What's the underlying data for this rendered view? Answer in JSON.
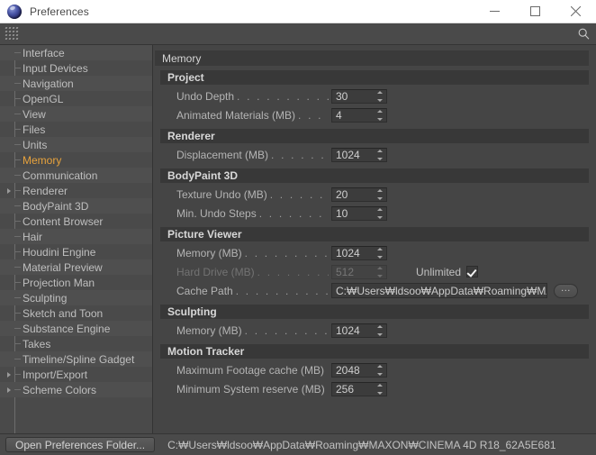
{
  "window": {
    "title": "Preferences",
    "app_icon": "cinema4d-sphere-icon",
    "minimize_label": "Minimize",
    "maximize_label": "Maximize",
    "close_label": "Close"
  },
  "toolbar": {
    "grip_name": "palette-grip",
    "search_icon": "search-icon"
  },
  "sidebar": {
    "items": [
      {
        "label": "Interface",
        "selected": false,
        "expandable": false
      },
      {
        "label": "Input Devices",
        "selected": false,
        "expandable": false
      },
      {
        "label": "Navigation",
        "selected": false,
        "expandable": false
      },
      {
        "label": "OpenGL",
        "selected": false,
        "expandable": false
      },
      {
        "label": "View",
        "selected": false,
        "expandable": false
      },
      {
        "label": "Files",
        "selected": false,
        "expandable": false
      },
      {
        "label": "Units",
        "selected": false,
        "expandable": false
      },
      {
        "label": "Memory",
        "selected": true,
        "expandable": false
      },
      {
        "label": "Communication",
        "selected": false,
        "expandable": false
      },
      {
        "label": "Renderer",
        "selected": false,
        "expandable": true
      },
      {
        "label": "BodyPaint 3D",
        "selected": false,
        "expandable": false
      },
      {
        "label": "Content Browser",
        "selected": false,
        "expandable": false
      },
      {
        "label": "Hair",
        "selected": false,
        "expandable": false
      },
      {
        "label": "Houdini Engine",
        "selected": false,
        "expandable": false
      },
      {
        "label": "Material Preview",
        "selected": false,
        "expandable": false
      },
      {
        "label": "Projection Man",
        "selected": false,
        "expandable": false
      },
      {
        "label": "Sculpting",
        "selected": false,
        "expandable": false
      },
      {
        "label": "Sketch and Toon",
        "selected": false,
        "expandable": false
      },
      {
        "label": "Substance Engine",
        "selected": false,
        "expandable": false
      },
      {
        "label": "Takes",
        "selected": false,
        "expandable": false
      },
      {
        "label": "Timeline/Spline Gadget",
        "selected": false,
        "expandable": false
      },
      {
        "label": "Import/Export",
        "selected": false,
        "expandable": true
      },
      {
        "label": "Scheme Colors",
        "selected": false,
        "expandable": true
      }
    ]
  },
  "panel": {
    "title": "Memory",
    "groups": [
      {
        "title": "Project",
        "rows": [
          {
            "label": "Undo Depth",
            "leader": ". . . . . . . . . . . . .",
            "type": "number",
            "value": "30",
            "disabled": false
          },
          {
            "label": "Animated Materials (MB)",
            "leader": ". . . .",
            "type": "number",
            "value": "4",
            "disabled": false
          }
        ]
      },
      {
        "title": "Renderer",
        "rows": [
          {
            "label": "Displacement (MB)",
            "leader": ". . . . . . . . .",
            "type": "number",
            "value": "1024",
            "disabled": false
          }
        ]
      },
      {
        "title": "BodyPaint 3D",
        "rows": [
          {
            "label": "Texture Undo (MB)",
            "leader": ". . . . . . . . .",
            "type": "number",
            "value": "20",
            "disabled": false
          },
          {
            "label": "Min. Undo Steps",
            "leader": ". . . . . . . . . . .",
            "type": "number",
            "value": "10",
            "disabled": false
          }
        ]
      },
      {
        "title": "Picture Viewer",
        "rows": [
          {
            "label": "Memory (MB)",
            "leader": ". . . . . . . . . . . . .",
            "type": "number",
            "value": "1024",
            "disabled": false
          },
          {
            "label": "Hard Drive (MB)",
            "leader": ". . . . . . . . . . . .",
            "type": "number-checkbox",
            "value": "512",
            "disabled": true,
            "checkbox_label": "Unlimited",
            "checked": true
          },
          {
            "label": "Cache Path",
            "leader": ". . . . . . . . . . . . . . .",
            "type": "path",
            "value": "C:₩Users₩ldsoo₩AppData₩Roaming₩MAXON",
            "browse_label": "...",
            "disabled": false
          }
        ]
      },
      {
        "title": "Sculpting",
        "rows": [
          {
            "label": "Memory (MB)",
            "leader": ". . . . . . . . . . . . .",
            "type": "number",
            "value": "1024",
            "disabled": false
          }
        ]
      },
      {
        "title": "Motion Tracker",
        "rows": [
          {
            "label": "Maximum Footage cache (MB)",
            "leader": "",
            "type": "number",
            "value": "2048",
            "disabled": false
          },
          {
            "label": "Minimum System reserve (MB)",
            "leader": "",
            "type": "number",
            "value": "256",
            "disabled": false
          }
        ]
      }
    ]
  },
  "statusbar": {
    "open_folder_label": "Open Preferences Folder...",
    "path": "C:₩Users₩ldsoo₩AppData₩Roaming₩MAXON₩CINEMA 4D R18_62A5E681"
  },
  "colors": {
    "window_chrome": "#ffffff",
    "panel_bg": "#454545",
    "sidebar_bg": "#4a4a4a",
    "group_header_bg": "#383838",
    "accent_selected": "#e8a33d",
    "text_primary": "#bfbfbf",
    "text_disabled": "#737373"
  }
}
